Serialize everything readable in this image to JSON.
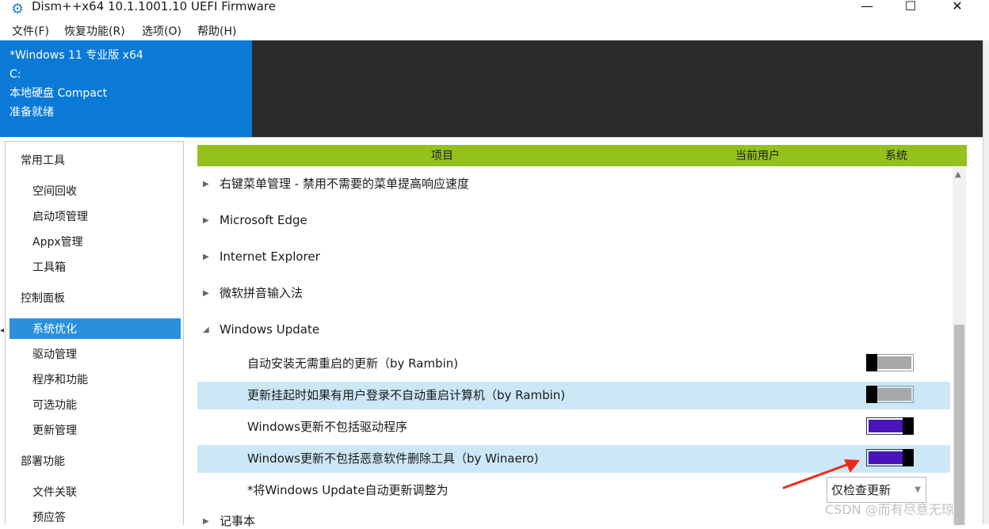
{
  "window": {
    "title": "Dism++x64 10.1.1001.10 UEFI Firmware",
    "controls": {
      "minimize": "—",
      "maximize": "☐",
      "close": "✕"
    }
  },
  "menu": [
    "文件(F)",
    "恢复功能(R)",
    "选项(O)",
    "帮助(H)"
  ],
  "image_info": {
    "edition": "*Windows 11 专业版 x64",
    "drive": "C:",
    "disk": "本地硬盘 Compact",
    "status": "准备就绪"
  },
  "sidebar": {
    "groups": [
      {
        "label": "常用工具",
        "items": [
          "空间回收",
          "启动项管理",
          "Appx管理",
          "工具箱"
        ]
      },
      {
        "label": "控制面板",
        "items": [
          "系统优化",
          "驱动管理",
          "程序和功能",
          "可选功能",
          "更新管理"
        ]
      },
      {
        "label": "部署功能",
        "items": [
          "文件关联",
          "预应答"
        ]
      }
    ],
    "selected": "系统优化"
  },
  "table": {
    "headers": {
      "item": "项目",
      "current_user": "当前用户",
      "system": "系统"
    },
    "categories": [
      {
        "label": "右键菜单管理 - 禁用不需要的菜单提高响应速度",
        "expanded": false
      },
      {
        "label": "Microsoft Edge",
        "expanded": false
      },
      {
        "label": "Internet Explorer",
        "expanded": false
      },
      {
        "label": "微软拼音输入法",
        "expanded": false
      },
      {
        "label": "Windows Update",
        "expanded": true
      }
    ],
    "options": [
      {
        "label": "自动安装无需重启的更新（by Rambin)",
        "state": "off",
        "highlighted": false
      },
      {
        "label": "更新挂起时如果有用户登录不自动重启计算机（by Rambin)",
        "state": "off",
        "highlighted": true
      },
      {
        "label": "Windows更新不包括驱动程序",
        "state": "on",
        "highlighted": false
      },
      {
        "label": "Windows更新不包括恶意软件删除工具（by Winaero)",
        "state": "on",
        "highlighted": true
      }
    ],
    "auto_update": {
      "label": "*将Windows Update自动更新调整为",
      "value": "仅检查更新"
    },
    "next_category": "记事本"
  },
  "watermark": "CSDN @而有尽意无琼",
  "colors": {
    "accent_blue": "#0a7ad6",
    "header_green": "#94c11e",
    "toggle_on": "#4a14b8",
    "row_highlight": "#cce8f7"
  }
}
